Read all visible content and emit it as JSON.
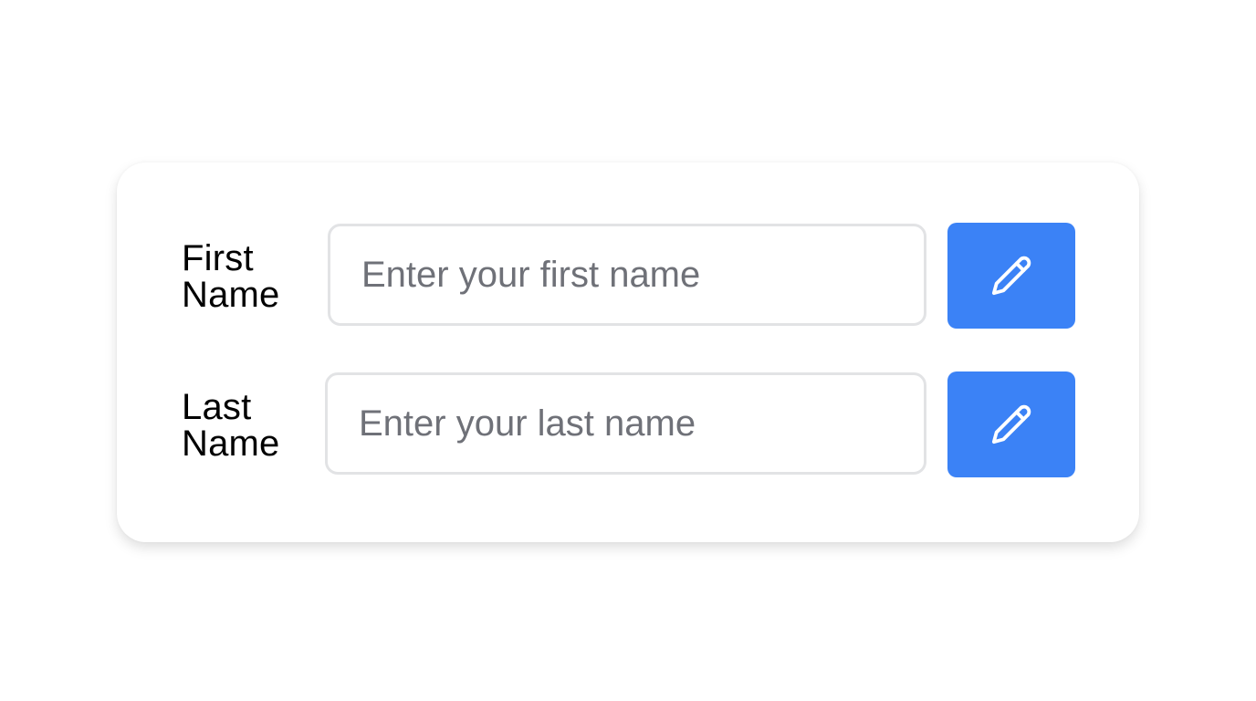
{
  "form": {
    "first_name": {
      "label_lines": [
        "First",
        "Name"
      ],
      "placeholder": "Enter your first name",
      "value": "",
      "edit_icon": "pencil-icon"
    },
    "last_name": {
      "label_lines": [
        "Last",
        "Name"
      ],
      "placeholder": "Enter your last name",
      "value": "",
      "edit_icon": "pencil-icon"
    }
  },
  "colors": {
    "button_bg": "#3b82f6",
    "input_border": "#e2e3e5",
    "placeholder": "#6f7178",
    "label": "#000000",
    "card_bg": "#ffffff"
  }
}
